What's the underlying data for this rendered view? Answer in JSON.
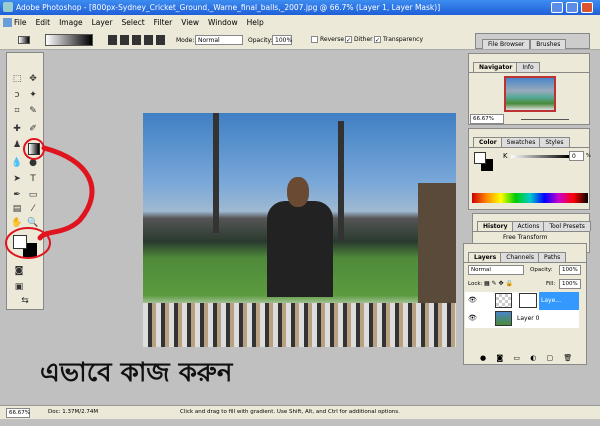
{
  "window": {
    "title": "Adobe Photoshop - [800px-Sydney_Cricket_Ground,_Warne_final_balls,_2007.jpg @ 66.7% (Layer 1, Layer Mask)]"
  },
  "menu": [
    "File",
    "Edit",
    "Image",
    "Layer",
    "Select",
    "Filter",
    "View",
    "Window",
    "Help"
  ],
  "options": {
    "mode_label": "Mode:",
    "mode_value": "Normal",
    "opacity_label": "Opacity:",
    "opacity_value": "100%",
    "reverse": "Reverse",
    "dither": "Dither",
    "transparency": "Transparency",
    "reverse_checked": false,
    "dither_checked": true,
    "transparency_checked": true
  },
  "palette_well": {
    "tabs": [
      "File Browser",
      "Brushes"
    ]
  },
  "navigator": {
    "tabs": [
      "Navigator",
      "Info"
    ],
    "zoom": "66.67%"
  },
  "color": {
    "tabs": [
      "Color",
      "Swatches",
      "Styles"
    ],
    "channel": "K",
    "value": "0",
    "unit": "%"
  },
  "history": {
    "tabs": [
      "History",
      "Actions",
      "Tool Presets"
    ],
    "items": [
      "Free Transform"
    ]
  },
  "layers": {
    "tabs": [
      "Layers",
      "Channels",
      "Paths"
    ],
    "blend": "Normal",
    "opacity_label": "Opacity:",
    "opacity": "100%",
    "lock_label": "Lock:",
    "fill_label": "Fill:",
    "fill": "100%",
    "items": [
      {
        "name": "Laye...",
        "selected": true
      },
      {
        "name": "Layer 0",
        "selected": false
      }
    ]
  },
  "status": {
    "zoom": "66.67%",
    "doc": "Doc: 1.37M/2.74M",
    "hint": "Click and drag to fill with gradient.  Use Shift, Alt, and Ctrl for additional options."
  },
  "caption": "এভাবে কাজ করুন",
  "colors": {
    "annotation": "#e0141e",
    "titlebar": "#2a6ae0",
    "selection": "#3399ff"
  }
}
